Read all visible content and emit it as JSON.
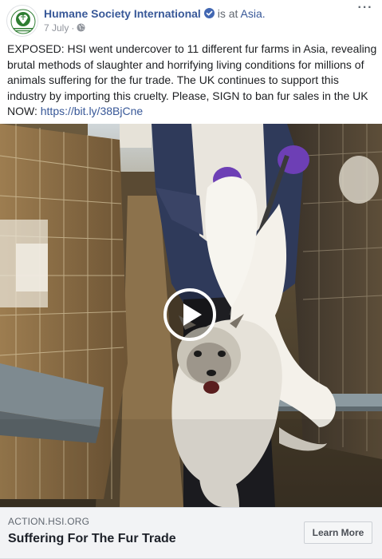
{
  "header": {
    "page_name": "Humane Society International",
    "is_at": " is at ",
    "location": "Asia.",
    "date": "7 July",
    "separator": "·",
    "more": "···",
    "avatar_text": "HUMANE SOCIETY INTERNATIONAL"
  },
  "post": {
    "text": "EXPOSED: HSI went undercover to 11 different fur farms in Asia, revealing brutal methods of slaughter and horrifying living conditions for millions of animals suffering for the fur trade. The UK continues to support this industry by importing this cruelty. Please, SIGN to ban fur sales in the UK NOW: ",
    "link": "https://bit.ly/38BjCne"
  },
  "link_card": {
    "domain": "ACTION.HSI.ORG",
    "title": "Suffering For The Fur Trade",
    "cta_label": "Learn More"
  },
  "icons": {
    "verified": "verified-badge-icon",
    "globe": "globe-icon",
    "play": "play-icon",
    "more": "more-options-icon"
  },
  "colors": {
    "link_blue": "#385898",
    "verified_blue": "#4267b2",
    "logo_green": "#2e7d32",
    "card_bg": "#f2f3f5"
  }
}
